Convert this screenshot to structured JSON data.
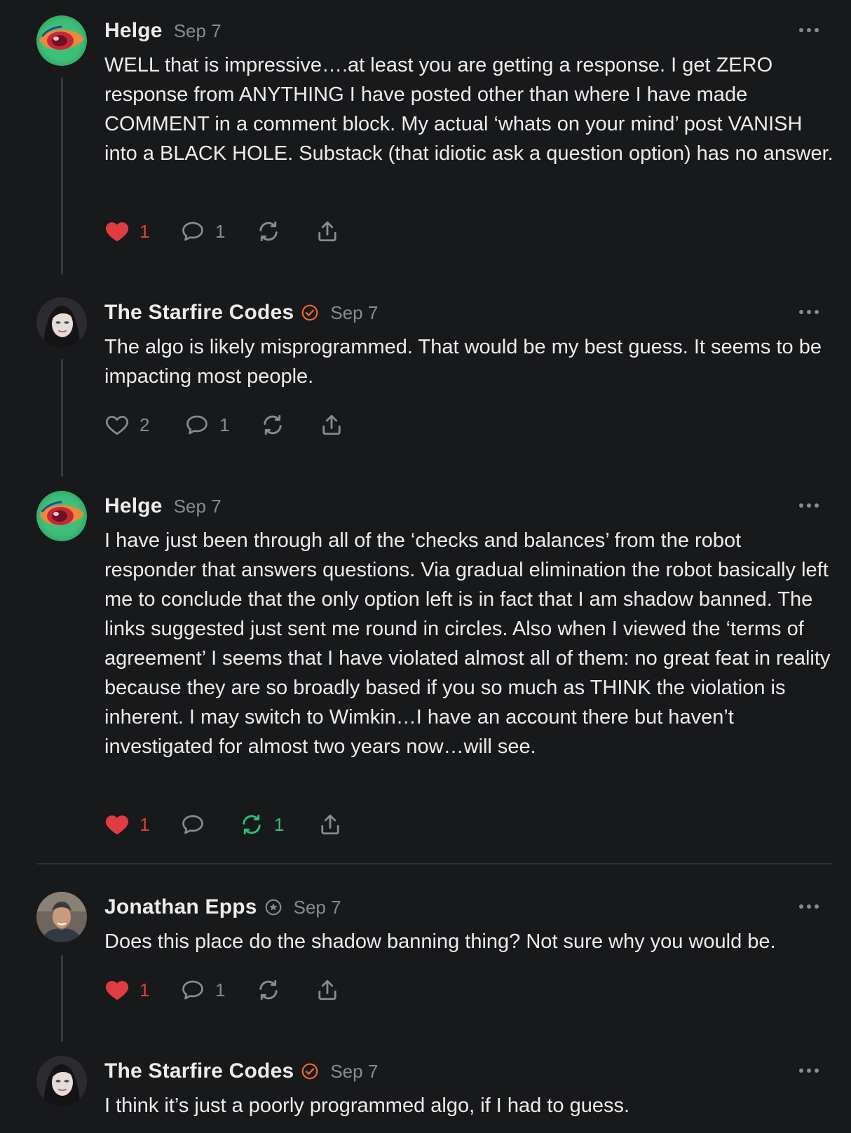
{
  "comments": [
    {
      "author": "Helge",
      "date": "Sep 7",
      "text": "WELL that is impressive….at least you are getting a response. I get ZERO response from ANYTHING I have posted other than where I have made COMMENT in a comment block. My actual ‘whats on your mind’ post VANISH into a BLACK HOLE. Substack (that idiotic ask a question option) has no answer.",
      "likes": "1",
      "replies": "1",
      "restacks": "",
      "liked": true,
      "restacked": false
    },
    {
      "author": "The Starfire Codes",
      "date": "Sep 7",
      "text": "The algo is likely misprogrammed. That would be my best guess. It seems to be impacting most people.",
      "likes": "2",
      "replies": "1",
      "restacks": "",
      "liked": false,
      "restacked": false
    },
    {
      "author": "Helge",
      "date": "Sep 7",
      "text": "I have just been through all of the ‘checks and balances’ from the robot responder that answers questions. Via gradual elimination the robot basically left me to conclude that the only option left is in fact that I am shadow banned. The links suggested just sent me round in circles. Also when I viewed the ‘terms of agreement’ I seems that I have violated almost all of them: no great feat in reality because they are so broadly based if you so much as THINK the violation is inherent. I may switch to Wimkin…I have an account there but haven’t investigated for almost two years now…will see.",
      "likes": "1",
      "replies": "",
      "restacks": "1",
      "liked": true,
      "restacked": true
    },
    {
      "author": "Jonathan Epps",
      "date": "Sep 7",
      "text": "Does this place do the shadow banning thing? Not sure why you would be.",
      "likes": "1",
      "replies": "1",
      "restacks": "",
      "liked": true,
      "restacked": false
    },
    {
      "author": "The Starfire Codes",
      "date": "Sep 7",
      "text": "I think it’s just a poorly programmed algo, if I had to guess."
    }
  ],
  "colors": {
    "background": "#18191b",
    "like_active": "#e23b44",
    "restack_active": "#2cc07a",
    "muted": "#8a8b8f",
    "verified_badge": "#ee6a2c"
  },
  "icons": [
    "heart-icon",
    "comment-icon",
    "restack-icon",
    "share-icon",
    "more-options-icon",
    "verified-badge-icon",
    "founder-badge-icon"
  ]
}
